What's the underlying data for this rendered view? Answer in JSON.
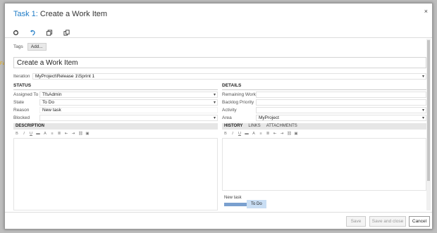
{
  "dialog": {
    "title_prefix": "Task 1:",
    "title": "Create a Work Item",
    "close_label": "×"
  },
  "toolbar": {
    "icons": [
      "refresh-icon",
      "undo-icon",
      "copy-link-icon",
      "copy-icon"
    ]
  },
  "tags": {
    "label": "Tags",
    "add_label": "Add..."
  },
  "work_item_title": "Create a Work Item",
  "iteration": {
    "label": "Iteration",
    "value": "MyProject\\Release 1\\Sprint 1"
  },
  "status": {
    "header": "STATUS",
    "fields": [
      {
        "label": "Assigned To",
        "value": "TfsAdmin"
      },
      {
        "label": "State",
        "value": "To Do"
      },
      {
        "label": "Reason",
        "value": "New task"
      },
      {
        "label": "Blocked",
        "value": ""
      }
    ]
  },
  "details": {
    "header": "DETAILS",
    "fields": [
      {
        "label": "Remaining Work",
        "value": ""
      },
      {
        "label": "Backlog Priority",
        "value": ""
      },
      {
        "label": "Activity",
        "value": ""
      },
      {
        "label": "Area",
        "value": "MyProject"
      }
    ]
  },
  "description": {
    "header": "DESCRIPTION"
  },
  "right_tabs": {
    "history": "HISTORY",
    "links": "LINKS",
    "attachments": "ATTACHMENTS"
  },
  "history": {
    "from": "New task",
    "to": "To Do"
  },
  "footer": {
    "save": "Save",
    "save_close": "Save and close",
    "cancel": "Cancel"
  },
  "colors": {
    "accent": "#1e7bc6",
    "history_state": "#c9def4"
  }
}
